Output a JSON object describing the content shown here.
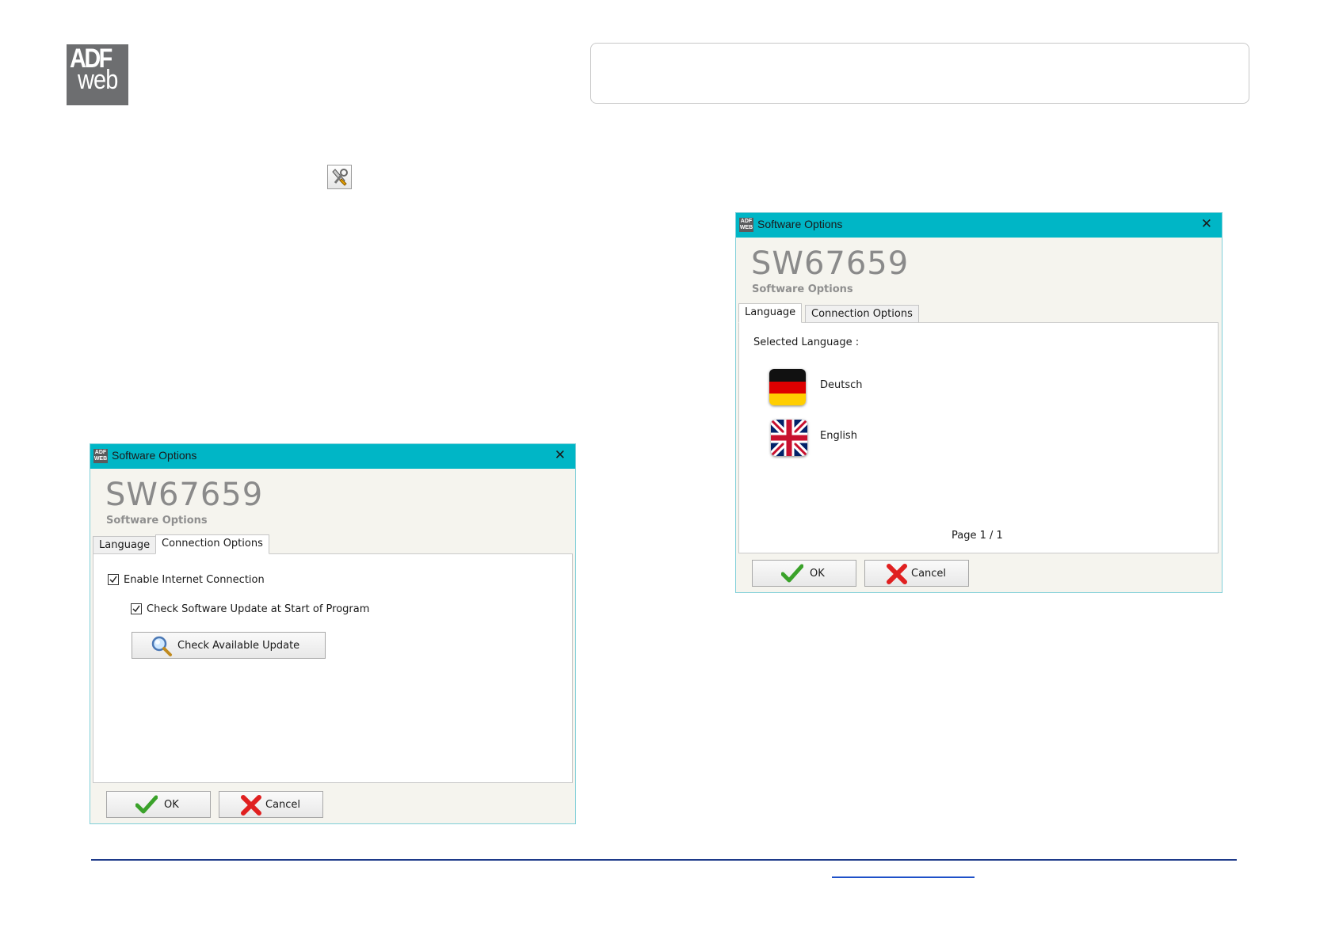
{
  "header": {
    "logo_top": "ADF",
    "logo_bottom": "web",
    "options_icon": "wrench-screwdriver-icon"
  },
  "dialog_connection": {
    "title": "Software Options",
    "code": "SW67659",
    "subtitle": "Software Options",
    "tabs": [
      {
        "label": "Language",
        "active": false
      },
      {
        "label": "Connection Options",
        "active": true
      }
    ],
    "enable_internet": {
      "label": "Enable Internet Connection",
      "checked": true
    },
    "check_update_start": {
      "label": "Check Software Update at Start of Program",
      "checked": true
    },
    "check_update_button": "Check Available Update",
    "ok_label": "OK",
    "cancel_label": "Cancel"
  },
  "dialog_language": {
    "title": "Software Options",
    "code": "SW67659",
    "subtitle": "Software Options",
    "tabs": [
      {
        "label": "Language",
        "active": true
      },
      {
        "label": "Connection Options",
        "active": false
      }
    ],
    "selected_language_label": "Selected Language :",
    "languages": [
      {
        "name": "Deutsch",
        "icon": "german-flag-icon"
      },
      {
        "name": "English",
        "icon": "uk-flag-icon"
      }
    ],
    "page_indicator": "Page 1 / 1",
    "ok_label": "OK",
    "cancel_label": "Cancel"
  },
  "colors": {
    "title_bar": "#00b6c6",
    "footer_line": "#1e3a8a"
  }
}
